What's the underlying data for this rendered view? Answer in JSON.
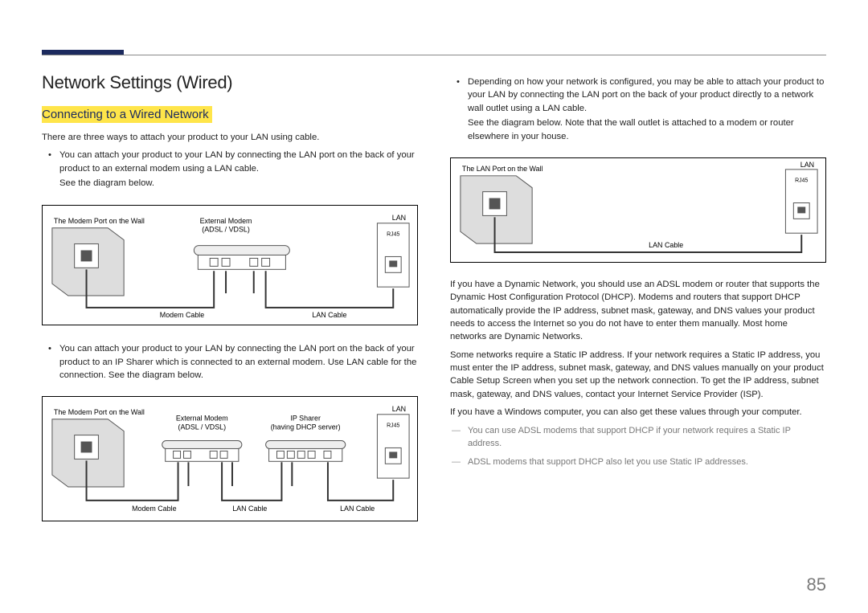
{
  "pageNumber": "85",
  "heading": "Network Settings (Wired)",
  "subheading": "Connecting to a Wired Network",
  "intro": "There are three ways to attach your product to your LAN using cable.",
  "left": {
    "bullet1": "You can attach your product to your LAN by connecting the LAN port on the back of your product to an external modem using a LAN cable.",
    "bullet1b": "See the diagram below.",
    "bullet2": "You can attach your product to your LAN by connecting the LAN port on the back of your product to an IP Sharer which is connected to an external modem. Use LAN cable for the connection. See the diagram below."
  },
  "right": {
    "bullet3": "Depending on how your network is configured, you may be able to attach your product to your LAN by connecting the LAN port on the back of your product directly to a network wall outlet using a LAN cable.",
    "bullet3b": "See the diagram below. Note that the wall outlet is attached to a modem or router elsewhere in your house.",
    "p1": "If you have a Dynamic Network, you should use an ADSL modem or router that supports the Dynamic Host Configuration Protocol (DHCP). Modems and routers that support DHCP automatically provide the IP address, subnet mask, gateway, and DNS values your product needs to access the Internet so you do not have to enter them manually. Most home networks are Dynamic Networks.",
    "p2": "Some networks require a Static IP address. If your network requires a Static IP address, you must enter the IP address, subnet mask, gateway, and DNS values manually on your product Cable Setup Screen when you set up the network connection. To get the IP address, subnet mask, gateway, and DNS values, contact your Internet Service Provider (ISP).",
    "p3": "If you have a Windows computer, you can also get these values through your computer.",
    "note1": "You can use ADSL modems that support DHCP if your network requires a Static IP address.",
    "note2": "ADSL modems that support DHCP also let you use Static IP addresses."
  },
  "diagram1": {
    "wall": "The Modem Port on the Wall",
    "modem": "External Modem",
    "modemSub": "(ADSL / VDSL)",
    "lan": "LAN",
    "rj45": "RJ45",
    "modemCable": "Modem Cable",
    "lanCable": "LAN Cable"
  },
  "diagram2": {
    "wall": "The Modem Port on the Wall",
    "modem": "External Modem",
    "modemSub": "(ADSL / VDSL)",
    "sharer": "IP Sharer",
    "sharerSub": "(having DHCP server)",
    "lan": "LAN",
    "rj45": "RJ45",
    "modemCable": "Modem Cable",
    "lanCable1": "LAN Cable",
    "lanCable2": "LAN Cable"
  },
  "diagram3": {
    "wall": "The LAN Port on the Wall",
    "lan": "LAN",
    "rj45": "RJ45",
    "lanCable": "LAN Cable"
  }
}
